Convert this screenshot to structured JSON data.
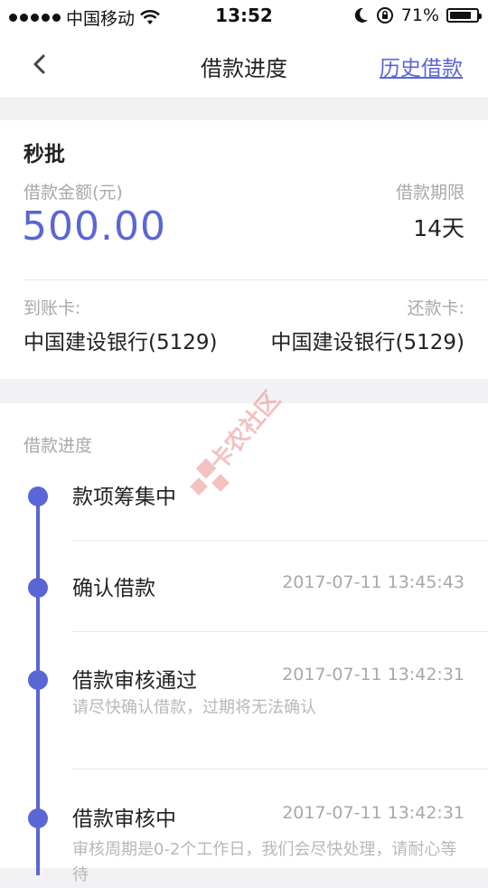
{
  "status_bar": {
    "carrier": "中国移动",
    "time": "13:52",
    "battery_percent": "71%",
    "battery_level": 0.71
  },
  "nav": {
    "title": "借款进度",
    "history_link": "历史借款"
  },
  "loan": {
    "product_name": "秒批",
    "amount_label": "借款金额(元)",
    "amount_value": "500.00",
    "term_label": "借款期限",
    "term_value": "14天",
    "receive_card_label": "到账卡:",
    "receive_card_value": "中国建设银行(5129)",
    "repay_card_label": "还款卡:",
    "repay_card_value": "中国建设银行(5129)"
  },
  "progress": {
    "title": "借款进度",
    "steps": [
      {
        "title": "款项筹集中",
        "time": "",
        "note": ""
      },
      {
        "title": "确认借款",
        "time": "2017-07-11 13:45:43",
        "note": ""
      },
      {
        "title": "借款审核通过",
        "time": "2017-07-11 13:42:31",
        "note": "请尽快确认借款，过期将无法确认"
      },
      {
        "title": "借款审核中",
        "time": "2017-07-11 13:42:31",
        "note": "审核周期是0-2个工作日，我们会尽快处理，请耐心等待"
      }
    ]
  },
  "watermark": {
    "text": "卡农社区"
  },
  "colors": {
    "accent": "#5a66d6",
    "muted_text": "#a8a8a8",
    "background": "#f2f2f4"
  }
}
